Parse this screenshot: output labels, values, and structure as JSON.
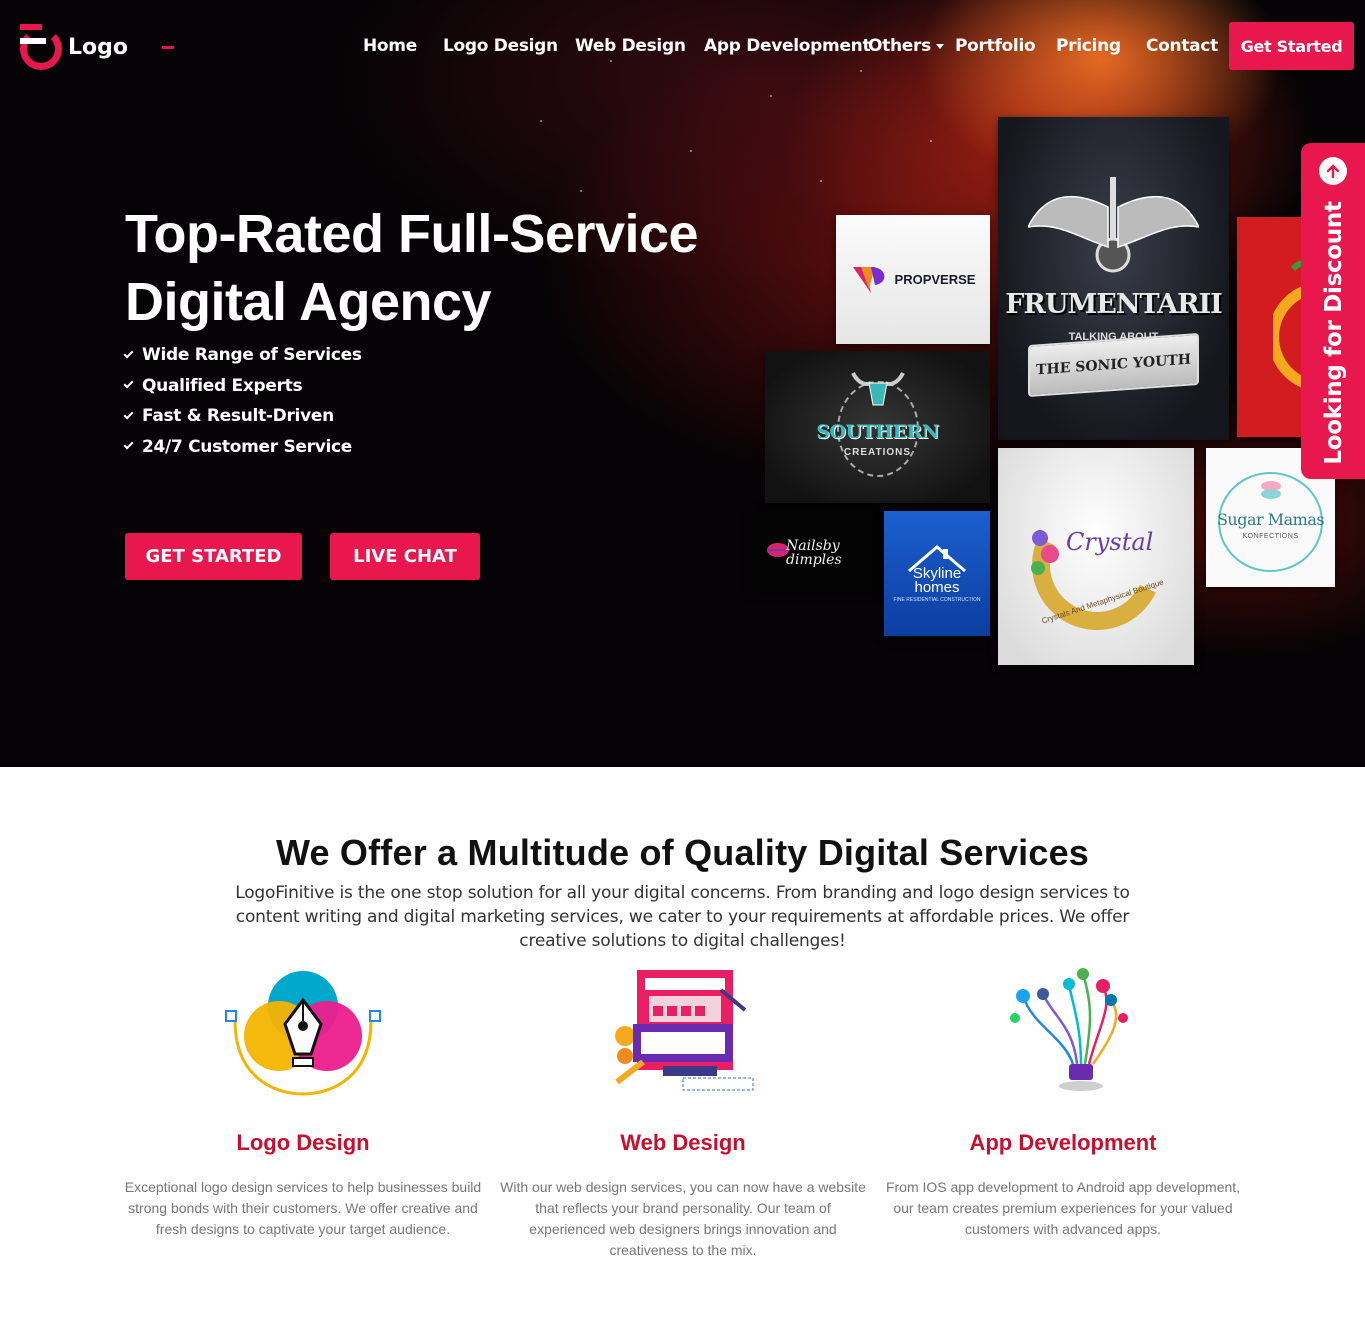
{
  "brand": {
    "name": "Logo"
  },
  "nav": {
    "items": [
      {
        "label": "Home"
      },
      {
        "label": "Logo Design"
      },
      {
        "label": "Web Design"
      },
      {
        "label": "App Development"
      },
      {
        "label": "Others"
      },
      {
        "label": "Portfolio"
      },
      {
        "label": "Pricing"
      },
      {
        "label": "Contact"
      }
    ],
    "cta_label": "Get Started"
  },
  "hero": {
    "title_line1": "Top-Rated Full-Service",
    "title_line2": "Digital Agency",
    "features": [
      "Wide Range of Services",
      "Qualified Experts",
      "Fast & Result-Driven",
      "24/7 Customer Service"
    ],
    "primary_button": "GET STARTED",
    "secondary_button": "LIVE CHAT"
  },
  "portfolio": {
    "propverse": "PROPVERSE",
    "frumentarii": "FRUMENTARII",
    "frumentarii_sub": "TALKING ABOUT",
    "frumentarii_banner": "THE SONIC YOUTH",
    "southern": "SOUTHERN",
    "southern_sub": "CREATIONS",
    "nails_line1": "Nailsby",
    "nails_line2": "dimples",
    "skyline_line1": "Skyline",
    "skyline_line2": "homes",
    "skyline_sub": "FINE RESIDENTIAL CONSTRUCTION",
    "crystal": "Crystal",
    "crystal_sub": "Crystals And Metaphysical Boutique",
    "sugar": "Sugar Mamas",
    "sugar_sub": "KONFECTIONS"
  },
  "discount_tab": {
    "label": "Looking for Discount"
  },
  "services": {
    "title": "We Offer a Multitude of Quality Digital Services",
    "description": "LogoFinitive is the one stop solution for all your digital concerns. From branding and logo design services to content writing and digital marketing services, we cater to your requirements at affordable prices. We offer creative solutions to digital challenges!",
    "items": [
      {
        "name": "Logo Design",
        "icon": "pen-nib-icon",
        "text": "Exceptional logo design services to help businesses build strong bonds with their customers. We offer creative and fresh designs to captivate your target audience."
      },
      {
        "name": "Web Design",
        "icon": "web-layout-icon",
        "text": "With our web design services, you can now have a website that reflects your brand personality. Our team of experienced web designers brings innovation and creativeness to the mix."
      },
      {
        "name": "App Development",
        "icon": "idea-bulb-apps-icon",
        "text": "From IOS app development to Android app development, our team creates premium experiences for your valued customers with advanced apps."
      }
    ]
  },
  "colors": {
    "accent": "#e8174d",
    "service_heading": "#c8102e",
    "hero_bg": "#050305"
  }
}
